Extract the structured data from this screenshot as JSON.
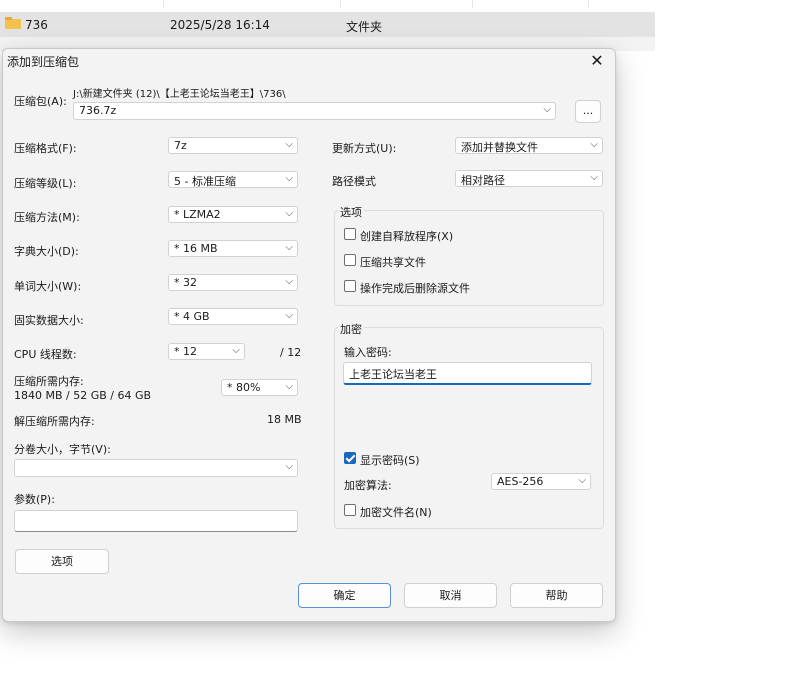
{
  "explorer": {
    "row": {
      "name": "736",
      "date": "2025/5/28 16:14",
      "type": "文件夹"
    }
  },
  "dialog": {
    "title": "添加到压缩包",
    "archive_label": "压缩包(A):",
    "archive_path": "J:\\新建文件夹 (12)\\【上老王论坛当老王】\\736\\",
    "archive_name": "736.7z",
    "browse_label": "...",
    "format_label": "压缩格式(F):",
    "format_value": "7z",
    "level_label": "压缩等级(L):",
    "level_value": "5 - 标准压缩",
    "method_label": "压缩方法(M):",
    "method_value": "* LZMA2",
    "dict_label": "字典大小(D):",
    "dict_value": "* 16 MB",
    "word_label": "单词大小(W):",
    "word_value": "* 32",
    "solid_label": "固实数据大小:",
    "solid_value": "* 4 GB",
    "cpu_label": "CPU 线程数:",
    "cpu_value": "* 12",
    "cpu_max": "/ 12",
    "mem_comp_label": "压缩所需内存:",
    "mem_comp_value": "1840 MB / 52 GB / 64 GB",
    "mem_percent": "* 80%",
    "mem_decomp_label": "解压缩所需内存:",
    "mem_decomp_value": "18 MB",
    "split_label": "分卷大小，字节(V):",
    "split_value": "",
    "params_label": "参数(P):",
    "params_value": "",
    "options_button": "选项",
    "update_label": "更新方式(U):",
    "update_value": "添加并替换文件",
    "path_label": "路径模式",
    "path_value": "相对路径",
    "options_group": {
      "title": "选项",
      "sfx": "创建自释放程序(X)",
      "shared": "压缩共享文件",
      "delete": "操作完成后删除源文件"
    },
    "encrypt_group": {
      "title": "加密",
      "password_label": "输入密码:",
      "password_value": "上老王论坛当老王",
      "show_password": "显示密码(S)",
      "method_label": "加密算法:",
      "method_value": "AES-256",
      "encrypt_names": "加密文件名(N)"
    },
    "ok": "确定",
    "cancel": "取消",
    "help": "帮助"
  },
  "icons": {
    "close": "close-icon",
    "chevron": "chevron-down-icon",
    "folder": "folder-icon",
    "check": "check-icon"
  },
  "colors": {
    "accent": "#1a67c2",
    "folder": "#f2c14e",
    "dialog_bg": "#f3f3f3"
  }
}
